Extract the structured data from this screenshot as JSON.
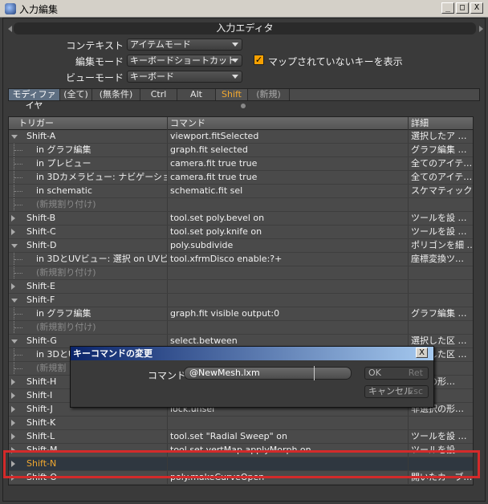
{
  "window": {
    "title": "入力編集",
    "min": "_",
    "max": "□",
    "close": "X"
  },
  "panel": {
    "title": "入力エディタ"
  },
  "form": {
    "context_label": "コンテキスト",
    "context_value": "アイテムモード",
    "edit_mode_label": "編集モード",
    "edit_mode_value": "キーボードショートカット",
    "view_mode_label": "ビューモード",
    "view_mode_value": "キーボード",
    "show_unmapped_label": "マップされていないキーを表示",
    "show_unmapped_checked": true,
    "check_glyph": "✓"
  },
  "tabs": [
    "モディファイヤ",
    "(全て)",
    "(無条件)",
    "Ctrl",
    "Alt",
    "Shift",
    "(新規)"
  ],
  "active_tab": "Shift",
  "table": {
    "headers": [
      "トリガー",
      "コマンド",
      "詳細"
    ],
    "rows": [
      {
        "trigger": "Shift-A",
        "command": "viewport.fitSelected",
        "detail": "選択したア …"
      },
      {
        "trigger": "in グラフ編集",
        "command": "graph.fit selected",
        "detail": "グラフ編集 …"
      },
      {
        "trigger": "in プレビュー",
        "command": "camera.fit true true",
        "detail": "全てのアイテ…"
      },
      {
        "trigger": "in 3Dカメラビュー: ナビゲーション",
        "command": "camera.fit true true",
        "detail": "全てのアイテ…"
      },
      {
        "trigger": "in schematic",
        "command": "schematic.fit sel",
        "detail": "スケマティック…"
      },
      {
        "trigger": "(新規割り付け)",
        "command": "",
        "detail": ""
      },
      {
        "trigger": "Shift-B",
        "command": "tool.set poly.bevel on",
        "detail": "ツールを設 …"
      },
      {
        "trigger": "Shift-C",
        "command": "tool.set poly.knife on",
        "detail": "ツールを設 …"
      },
      {
        "trigger": "Shift-D",
        "command": "poly.subdivide",
        "detail": "ポリゴンを細 …"
      },
      {
        "trigger": "in 3DとUVビュー: 選択 on UVビュー",
        "command": "tool.xfrmDisco enable:?+",
        "detail": "座標変換ツ…"
      },
      {
        "trigger": "(新規割り付け)",
        "command": "",
        "detail": ""
      },
      {
        "trigger": "Shift-E",
        "command": "",
        "detail": ""
      },
      {
        "trigger": "Shift-F",
        "command": "",
        "detail": ""
      },
      {
        "trigger": "in グラフ編集",
        "command": "graph.fit visible output:0",
        "detail": "グラフ編集 …"
      },
      {
        "trigger": "(新規割り付け)",
        "command": "",
        "detail": ""
      },
      {
        "trigger": "Shift-G",
        "command": "select.between",
        "detail": "選択した区 …"
      },
      {
        "trigger": "in 3DとUV",
        "command": "",
        "detail": "選択した区 …"
      },
      {
        "trigger": "(新規割",
        "command": "",
        "detail": ""
      },
      {
        "trigger": "Shift-H",
        "command": "",
        "detail": "選択の形…"
      },
      {
        "trigger": "Shift-I",
        "command": "",
        "detail": ""
      },
      {
        "trigger": "Shift-J",
        "command": "lock.unsel",
        "detail": "非選択の形…"
      },
      {
        "trigger": "Shift-K",
        "command": "",
        "detail": ""
      },
      {
        "trigger": "Shift-L",
        "command": "tool.set \"Radial Sweep\" on",
        "detail": "ツールを設 …"
      },
      {
        "trigger": "Shift-M",
        "command": "tool.set vertMap.applyMorph on",
        "detail": "ツールを設 …"
      },
      {
        "trigger": "Shift-N",
        "command": "",
        "detail": ""
      },
      {
        "trigger": "Shift-O",
        "command": "poly.makeCurveOpen",
        "detail": "開いたカーブ…"
      }
    ]
  },
  "dialog": {
    "title": "キーコマンドの変更",
    "close": "X",
    "command_label": "コマンド",
    "command_value": "@NewMesh.lxm",
    "ok_label": "OK",
    "ok_key": "Ret",
    "cancel_label": "キャンセル",
    "cancel_key": "Esc"
  },
  "colors": {
    "highlight": "#d42a2a",
    "accent": "#f0a830",
    "checkbox": "#f5a000",
    "dialog_title": "#0a246a"
  }
}
